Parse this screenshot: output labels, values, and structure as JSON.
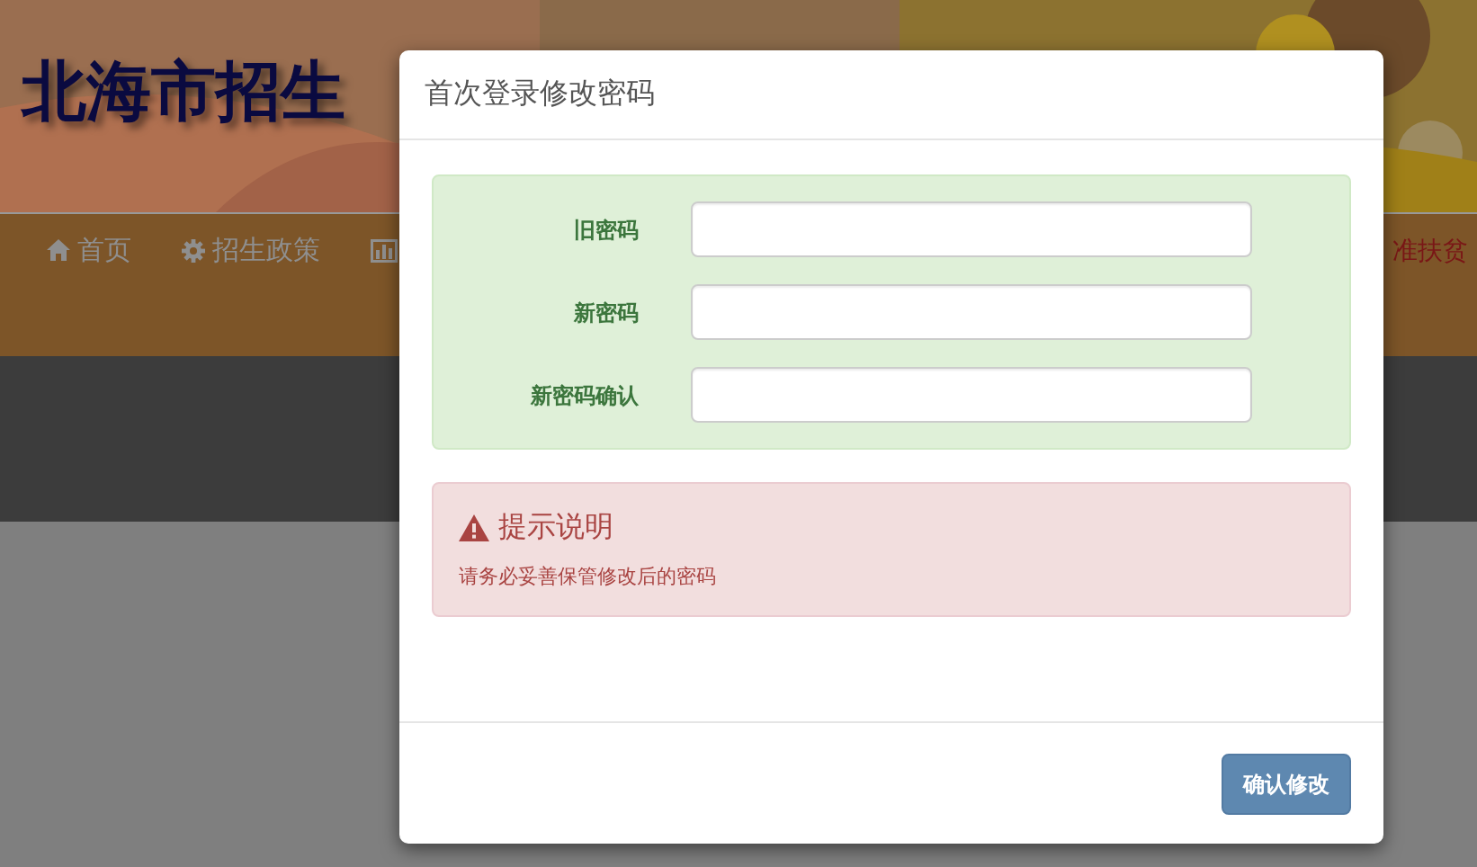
{
  "banner": {
    "title": "北海市招生"
  },
  "nav": [
    {
      "kind": "home",
      "label": "首页"
    },
    {
      "kind": "gear",
      "label": "招生政策"
    },
    {
      "kind": "chart"
    }
  ],
  "nav_right": {
    "label": "准扶贫"
  },
  "modal": {
    "title": "首次登录修改密码",
    "fields": [
      {
        "label": "旧密码"
      },
      {
        "label": "新密码"
      },
      {
        "label": "新密码确认"
      }
    ],
    "alert": {
      "title": "提示说明",
      "text": "请务必妥善保管修改后的密码"
    },
    "button": "确认修改"
  }
}
